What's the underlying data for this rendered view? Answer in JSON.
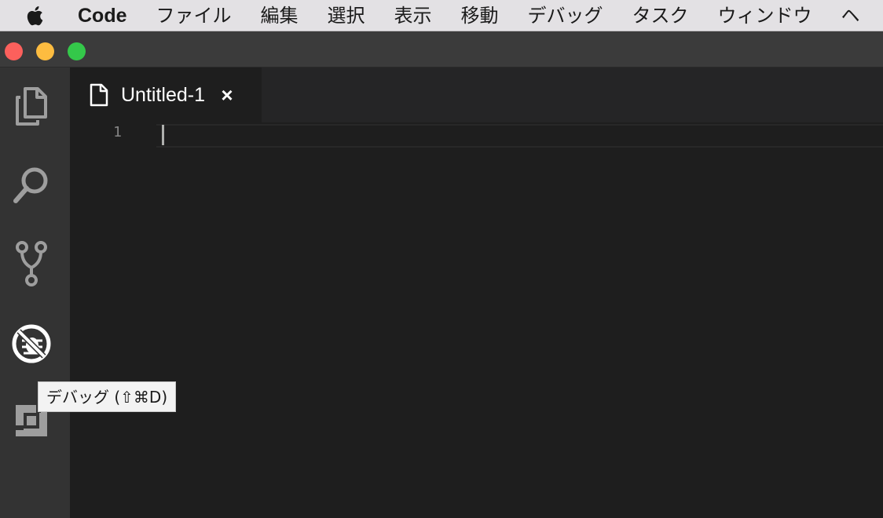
{
  "menubar": {
    "apple_icon": "apple-logo",
    "app_name": "Code",
    "items": [
      "ファイル",
      "編集",
      "選択",
      "表示",
      "移動",
      "デバッグ",
      "タスク",
      "ウィンドウ",
      "ヘ"
    ]
  },
  "window": {
    "controls": [
      "close",
      "minimize",
      "maximize"
    ]
  },
  "activity_bar": {
    "items": [
      {
        "name": "explorer",
        "icon": "files-icon"
      },
      {
        "name": "search",
        "icon": "search-icon"
      },
      {
        "name": "source-control",
        "icon": "git-branch-icon"
      },
      {
        "name": "debug",
        "icon": "debug-icon"
      },
      {
        "name": "extensions",
        "icon": "extensions-icon"
      }
    ]
  },
  "tooltip": {
    "text": "デバッグ (⇧⌘D)"
  },
  "editor": {
    "tabs": [
      {
        "label": "Untitled-1",
        "icon": "file-icon",
        "close": "×"
      }
    ],
    "line_numbers": [
      "1"
    ]
  },
  "colors": {
    "editor_bg": "#1e1e1e",
    "activity_bar_bg": "#333333",
    "menubar_bg": "#e3e1e4",
    "traffic_close": "#fc605c",
    "traffic_min": "#fdbc40",
    "traffic_max": "#34c84a"
  }
}
